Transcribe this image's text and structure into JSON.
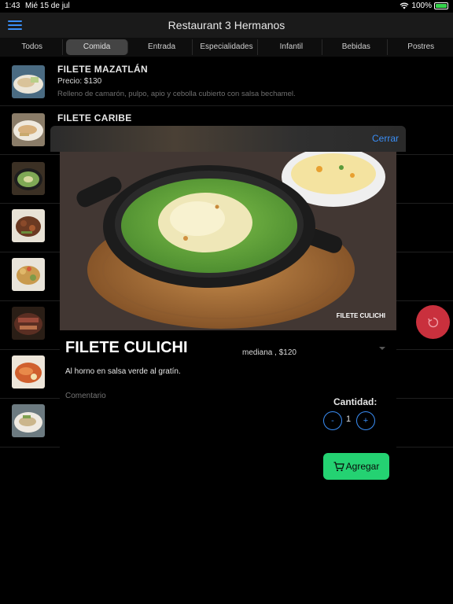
{
  "status_bar": {
    "time": "1:43",
    "date": "Mié 15 de jul",
    "battery": "100%"
  },
  "header": {
    "title": "Restaurant 3 Hermanos"
  },
  "tabs": [
    {
      "label": "Todos"
    },
    {
      "label": "Comida"
    },
    {
      "label": "Entrada"
    },
    {
      "label": "Especialidades"
    },
    {
      "label": "Infantil"
    },
    {
      "label": "Bebidas"
    },
    {
      "label": "Postres"
    }
  ],
  "list": [
    {
      "title": "FILETE MAZATLÁN",
      "price": "Precio: $130",
      "description": "Relleno de camarón, pulpo, apio y cebolla cubierto con salsa bechamel."
    },
    {
      "title": "FILETE CARIBE"
    }
  ],
  "modal": {
    "close_label": "Cerrar",
    "image_caption": "FILETE CULICHI",
    "dish_name": "FILETE CULICHI",
    "size_value": "mediana , $120",
    "description": "Al horno en salsa verde al gratín.",
    "comment_placeholder": "Comentario",
    "quantity_label": "Cantidad:",
    "minus_label": "-",
    "quantity": "1",
    "plus_label": "+",
    "add_label": "Agregar"
  },
  "colors": {
    "accent": "#3a8ef6",
    "add_button": "#24d272",
    "fab": "#c9303d"
  }
}
